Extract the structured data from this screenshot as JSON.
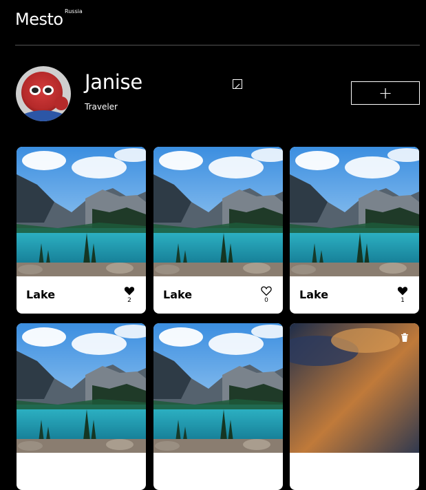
{
  "header": {
    "logo_text": "Mesto",
    "logo_sup": "Russia"
  },
  "profile": {
    "name": "Janise",
    "about": "Traveler",
    "add_button": "+"
  },
  "cards": [
    {
      "title": "Lake",
      "likes": "2",
      "liked": true
    },
    {
      "title": "Lake",
      "likes": "0",
      "liked": false
    },
    {
      "title": "Lake",
      "likes": "1",
      "liked": true
    },
    {
      "title": "",
      "likes": "",
      "liked": false
    },
    {
      "title": "",
      "likes": "",
      "liked": false
    },
    {
      "title": "",
      "likes": "",
      "liked": false
    }
  ],
  "colors": {
    "page_bg": "#000000",
    "card_bg": "#ffffff",
    "divider": "#545454"
  }
}
